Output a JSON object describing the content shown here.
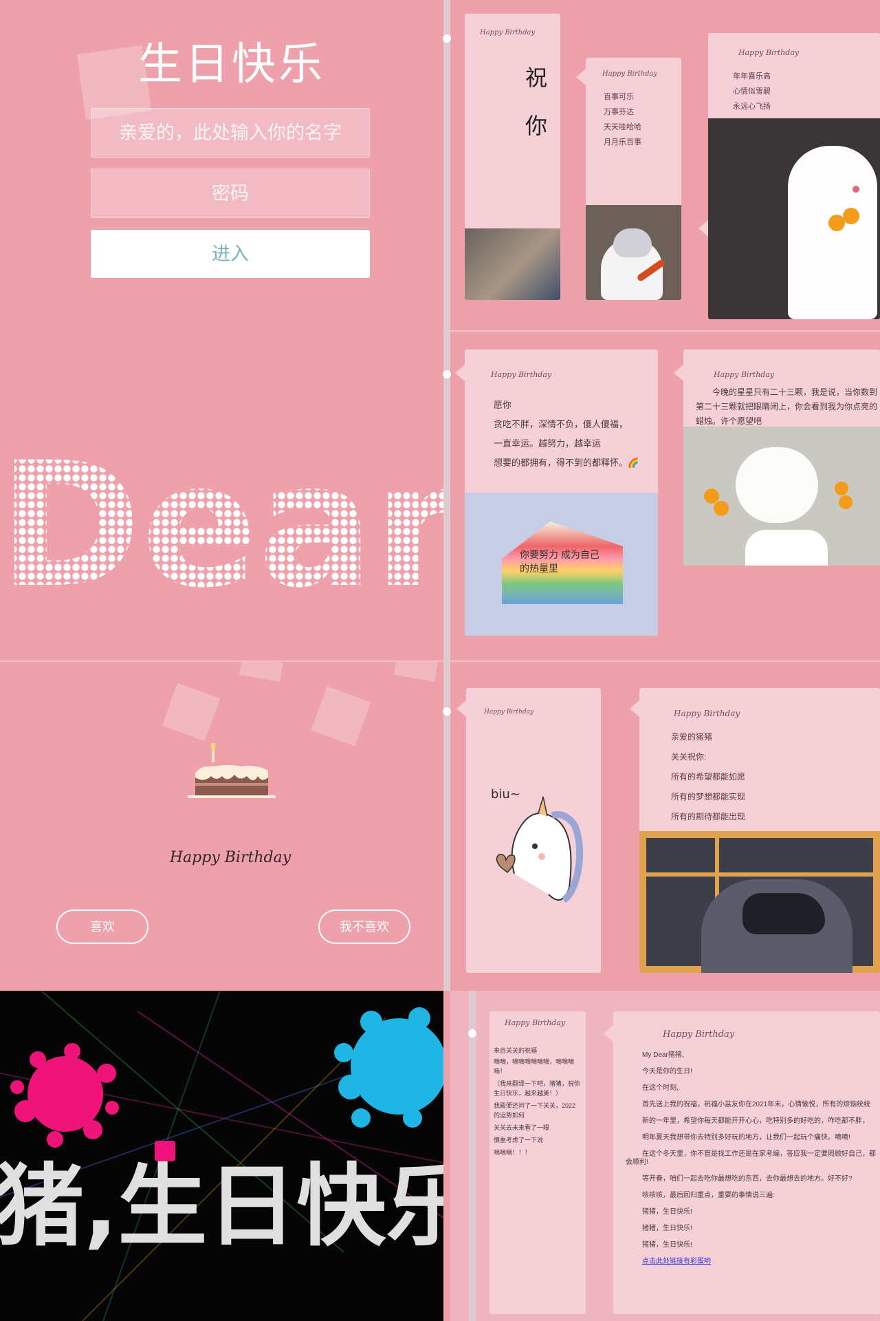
{
  "login": {
    "title": "生日快乐",
    "name_placeholder": "亲爱的，此处输入你的名字",
    "password_placeholder": "密码",
    "enter_label": "进入",
    "dear_text": "Dear"
  },
  "cake_page": {
    "script_title": "Happy Birthday",
    "like_label": "喜欢",
    "dislike_label": "我不喜欢"
  },
  "fireworks": {
    "text": "猪,生日快乐"
  },
  "slide1": {
    "card_a": {
      "script": "Happy Birthday",
      "chars": [
        "祝",
        "你"
      ]
    },
    "card_b": {
      "script": "Happy Birthday",
      "lines": [
        "百事可乐",
        "万事芬达",
        "天天哇哈哈",
        "月月乐百事"
      ]
    },
    "card_c": {
      "script": "Happy Birthday",
      "lines": [
        "年年喜乐高",
        "心情似雪碧",
        "永远心飞扬"
      ]
    }
  },
  "slide2": {
    "card_a": {
      "script": "Happy Birthday",
      "lines": [
        "愿你",
        "贪吃不胖，深情不负，傻人傻福，",
        "一直幸运。越努力，越幸运",
        "想要的都拥有，得不到的都释怀。🌈"
      ]
    },
    "card_b": {
      "script": "Happy Birthday",
      "text": "今晚的星星只有二十三颗，我是说，当你数到第二十三颗就把眼睛闭上，你会看到我为你点亮的蜡烛。许个愿望吧"
    },
    "cake_text": "你要努力 成为自己 的热量里"
  },
  "slide3": {
    "card_a": {
      "script": "Happy Birthday",
      "doodle_text": "biu~"
    },
    "card_b": {
      "script": "Happy Birthday",
      "lines": [
        "亲爱的猪猪",
        "关关祝你:",
        "所有的希望都能如愿",
        "所有的梦想都能实现",
        "所有的期待都能出现"
      ]
    }
  },
  "slide4": {
    "card_a": {
      "script": "Happy Birthday",
      "lines": [
        "来自关关的祝福",
        "嘀嘀，嘀嘀嘀嘀嘀嘀，嘀嘀嘀嘀！",
        "（我来翻译一下吧，猪猪，祝你生日快乐，越来越美！）",
        "我殿便还问了一下关关，2022的运势如何",
        "关关去未来看了一眼",
        "慎重考虑了一下说",
        "嘀嘀嘀！！！"
      ]
    },
    "card_b": {
      "script": "Happy Birthday",
      "lines": [
        "My Dear猪猪,",
        "今天是你的生日!",
        "在这个时刻,",
        "首先送上我的祝福，祝福小盆友你在2021年末，心情愉悦，所有的烦恼统统",
        "新的一年里，希望你每天都能开开心心，吃特别多的好吃的，咋吃都不胖，",
        "明年夏天我想带你去特别多好玩的地方，让我们一起玩个痛快。嘀嘀!",
        "在这个冬天里，你不管是找工作还是在家考编，答应我一定要照顾好自己，都会顺利!",
        "等开春，咱们一起去吃你最想吃的东西，去你最想去的地方。好不好?",
        "咳咳咳，最后回归重点，重要的事情说三遍:",
        "猪猪，生日快乐!",
        "猪猪，生日快乐!",
        "猪猪，生日快乐!"
      ],
      "link_text": "点击此处链接有彩蛋哟"
    }
  },
  "colors": {
    "bg_pink": "#eea0ab",
    "card_pink": "#f6d0d7",
    "button_text": "#7fb3b3",
    "fireworks_magenta": "#f0147a",
    "fireworks_cyan": "#1fb6e6"
  }
}
